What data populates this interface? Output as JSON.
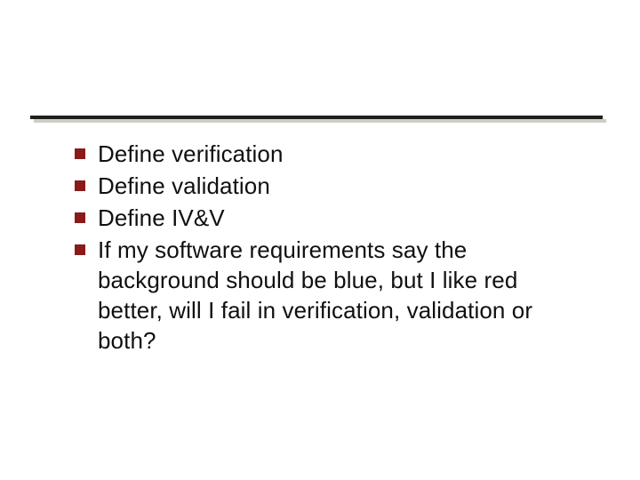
{
  "bullets": [
    {
      "text": "Define verification"
    },
    {
      "text": "Define validation"
    },
    {
      "text": "Define IV&V"
    },
    {
      "text": "If my software requirements say the background should be blue, but I like red better, will I fail in verification, validation or both?"
    }
  ]
}
